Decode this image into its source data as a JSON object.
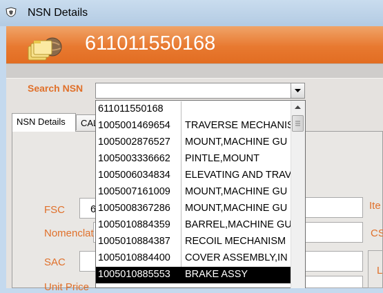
{
  "window": {
    "title": "NSN Details"
  },
  "header": {
    "nsn": "611011550168"
  },
  "search": {
    "label": "Search NSN",
    "value": ""
  },
  "tabs": [
    {
      "label": "NSN Details",
      "active": true
    },
    {
      "label": "CAL",
      "active": false
    }
  ],
  "form": {
    "fsc_label": "FSC",
    "fsc_value": "6",
    "nomenclature_label": "Nomenclat",
    "sac_label": "SAC",
    "unit_price_label": "Unit Price",
    "item_label": "Ite",
    "cs_label": "CS",
    "l_label": "L"
  },
  "dropdown": {
    "options": [
      {
        "code": "611011550168",
        "desc": ""
      },
      {
        "code": "1005001469654",
        "desc": "TRAVERSE MECHANIS"
      },
      {
        "code": "1005002876527",
        "desc": "MOUNT,MACHINE GU"
      },
      {
        "code": "1005003336662",
        "desc": "PINTLE,MOUNT"
      },
      {
        "code": "1005006034834",
        "desc": "ELEVATING AND TRAV"
      },
      {
        "code": "1005007161009",
        "desc": "MOUNT,MACHINE GU"
      },
      {
        "code": "1005008367286",
        "desc": "MOUNT,MACHINE GU"
      },
      {
        "code": "1005010884359",
        "desc": "BARREL,MACHINE GU"
      },
      {
        "code": "1005010884387",
        "desc": "RECOIL MECHANISM"
      },
      {
        "code": "1005010884400",
        "desc": "COVER ASSEMBLY,IN"
      },
      {
        "code": "1005010885553",
        "desc": "BRAKE ASSY"
      }
    ],
    "selected_index": 10
  },
  "colors": {
    "accent": "#e0702a",
    "header": "#e87930",
    "titlebar": "#c4d9ee"
  }
}
